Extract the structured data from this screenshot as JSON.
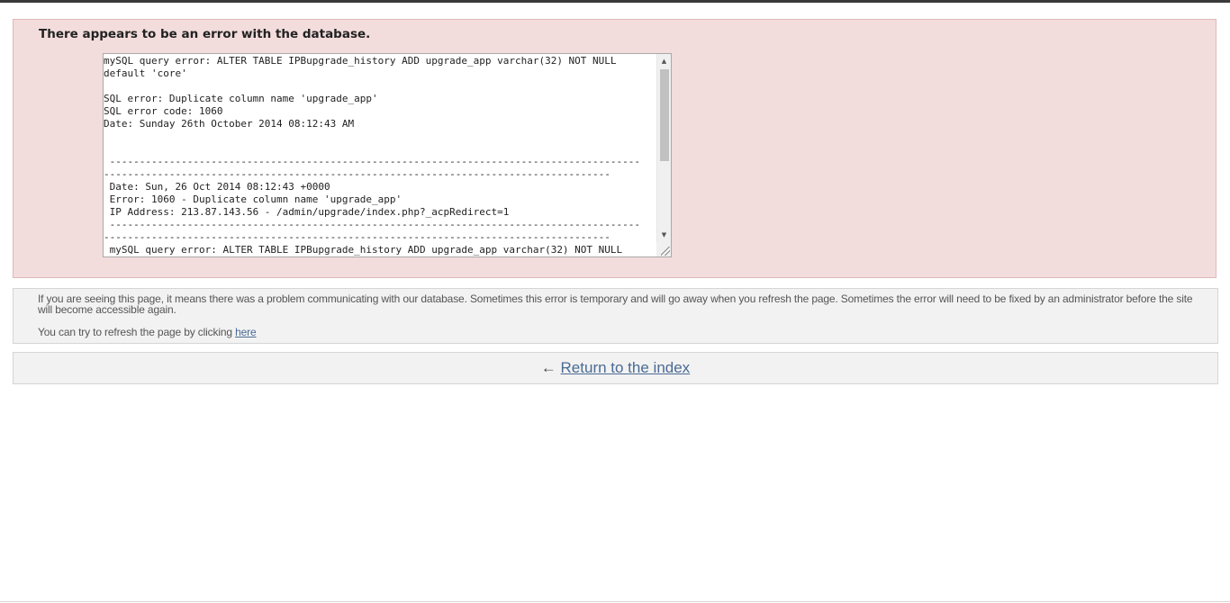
{
  "error": {
    "title": "There appears to be an error with the database.",
    "details": "mySQL query error: ALTER TABLE IPBupgrade_history ADD upgrade_app varchar(32) NOT NULL\ndefault 'core'\n\nSQL error: Duplicate column name 'upgrade_app'\nSQL error code: 1060\nDate: Sunday 26th October 2014 08:12:43 AM\n\n\n -----------------------------------------------------------------------------------------\n-------------------------------------------------------------------------------------\n Date: Sun, 26 Oct 2014 08:12:43 +0000\n Error: 1060 - Duplicate column name 'upgrade_app'\n IP Address: 213.87.143.56 - /admin/upgrade/index.php?_acpRedirect=1\n -----------------------------------------------------------------------------------------\n-------------------------------------------------------------------------------------\n mySQL query error: ALTER TABLE IPBupgrade_history ADD upgrade_app varchar(32) NOT NULL"
  },
  "info": {
    "message": "If you are seeing this page, it means there was a problem communicating with our database. Sometimes this error is temporary and will go away when you refresh the page. Sometimes the error will need to be fixed by an administrator before the site will become accessible again.",
    "refresh_prefix": "You can try to refresh the page by clicking ",
    "refresh_link": "here"
  },
  "return": {
    "arrow": "←",
    "label": "Return to the index"
  },
  "icons": {
    "scroll_up": "up-arrow-icon",
    "scroll_down": "down-arrow-icon",
    "resize": "resize-grip-icon"
  },
  "colors": {
    "error_background": "#f3dcdc",
    "panel_background": "#f2f2f2",
    "link": "#4a6b94"
  }
}
